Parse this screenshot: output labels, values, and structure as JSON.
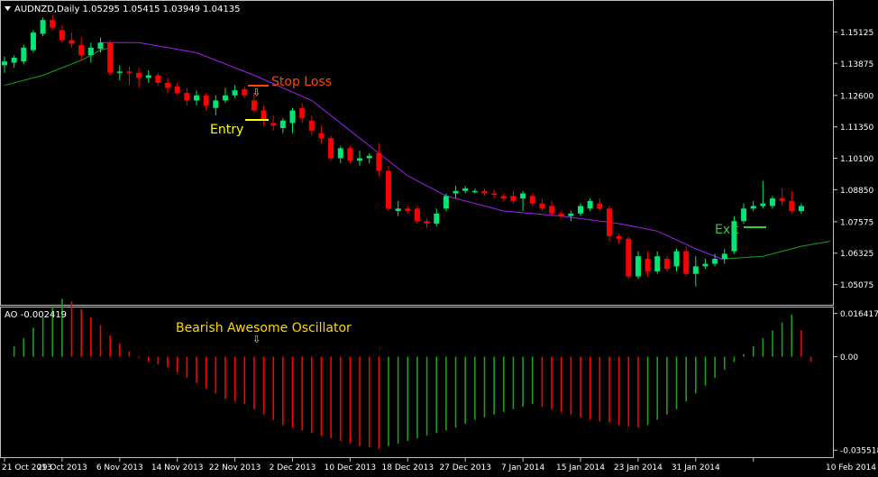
{
  "window": {
    "symbol_header": "AUDNZD,Daily  1.05295 1.05415 1.03949 1.04135",
    "indicator_header": "AO -0.002419"
  },
  "colors": {
    "background": "#000000",
    "frame": "#c0c0c0",
    "axis_text": "#ffffff",
    "bull": "#00e676",
    "bear": "#ff0000",
    "ma_purple": "#a020f0",
    "ma_green": "#1e9e1e",
    "ao_up": "#1e9e1e",
    "ao_down": "#ff0000",
    "entry_label": "#ffff00",
    "stop_label": "#ff4500",
    "exit_label": "#33cc33",
    "ao_label": "#ffd700"
  },
  "annotations": {
    "stop_loss": "Stop Loss",
    "entry": "Entry",
    "exit": "Exit",
    "ao_note": "Bearish Awesome Oscillator",
    "arrow_glyph": "⇩"
  },
  "chart_data": [
    {
      "type": "candlestick",
      "title": "AUDNZD,Daily",
      "ohlc_readout": [
        1.05295,
        1.05415,
        1.03949,
        1.04135
      ],
      "y_ticks": [
        1.15125,
        1.13875,
        1.126,
        1.1135,
        1.101,
        1.0885,
        1.07575,
        1.06325,
        1.05075
      ],
      "y_tick_labels": [
        "1.15125",
        "1.13875",
        "1.12600",
        "1.11350",
        "1.10100",
        "1.08850",
        "1.07575",
        "1.06325",
        "1.05075"
      ],
      "ylim": [
        1.0445,
        1.1575
      ],
      "x_tick_labels": [
        "21 Oct 2013",
        "29 Oct 2013",
        "6 Nov 2013",
        "14 Nov 2013",
        "22 Nov 2013",
        "2 Dec 2013",
        "10 Dec 2013",
        "18 Dec 2013",
        "27 Dec 2013",
        "7 Jan 2014",
        "15 Jan 2014",
        "23 Jan 2014",
        "31 Jan 2014",
        "10 Feb 2014"
      ],
      "x_tick_bar_index": [
        0,
        6,
        12,
        18,
        24,
        30,
        36,
        42,
        48,
        54,
        60,
        66,
        72,
        78
      ],
      "candles": [
        {
          "o": 1.138,
          "h": 1.1415,
          "l": 1.135,
          "c": 1.1395
        },
        {
          "o": 1.139,
          "h": 1.142,
          "l": 1.137,
          "c": 1.141
        },
        {
          "o": 1.1395,
          "h": 1.146,
          "l": 1.1385,
          "c": 1.145
        },
        {
          "o": 1.144,
          "h": 1.152,
          "l": 1.143,
          "c": 1.151
        },
        {
          "o": 1.1505,
          "h": 1.157,
          "l": 1.1495,
          "c": 1.156
        },
        {
          "o": 1.156,
          "h": 1.158,
          "l": 1.152,
          "c": 1.153
        },
        {
          "o": 1.152,
          "h": 1.154,
          "l": 1.147,
          "c": 1.148
        },
        {
          "o": 1.148,
          "h": 1.151,
          "l": 1.145,
          "c": 1.1465
        },
        {
          "o": 1.146,
          "h": 1.149,
          "l": 1.14,
          "c": 1.142
        },
        {
          "o": 1.142,
          "h": 1.147,
          "l": 1.139,
          "c": 1.145
        },
        {
          "o": 1.1445,
          "h": 1.149,
          "l": 1.143,
          "c": 1.147
        },
        {
          "o": 1.147,
          "h": 1.148,
          "l": 1.134,
          "c": 1.135
        },
        {
          "o": 1.135,
          "h": 1.138,
          "l": 1.132,
          "c": 1.1355
        },
        {
          "o": 1.1355,
          "h": 1.1375,
          "l": 1.13,
          "c": 1.135
        },
        {
          "o": 1.135,
          "h": 1.137,
          "l": 1.129,
          "c": 1.133
        },
        {
          "o": 1.133,
          "h": 1.136,
          "l": 1.131,
          "c": 1.134
        },
        {
          "o": 1.134,
          "h": 1.135,
          "l": 1.13,
          "c": 1.131
        },
        {
          "o": 1.131,
          "h": 1.133,
          "l": 1.127,
          "c": 1.129
        },
        {
          "o": 1.1295,
          "h": 1.131,
          "l": 1.126,
          "c": 1.127
        },
        {
          "o": 1.127,
          "h": 1.129,
          "l": 1.122,
          "c": 1.124
        },
        {
          "o": 1.124,
          "h": 1.128,
          "l": 1.122,
          "c": 1.126
        },
        {
          "o": 1.126,
          "h": 1.127,
          "l": 1.12,
          "c": 1.122
        },
        {
          "o": 1.121,
          "h": 1.126,
          "l": 1.118,
          "c": 1.124
        },
        {
          "o": 1.124,
          "h": 1.129,
          "l": 1.123,
          "c": 1.126
        },
        {
          "o": 1.126,
          "h": 1.13,
          "l": 1.125,
          "c": 1.128
        },
        {
          "o": 1.1285,
          "h": 1.1295,
          "l": 1.125,
          "c": 1.126
        },
        {
          "o": 1.124,
          "h": 1.127,
          "l": 1.119,
          "c": 1.12
        },
        {
          "o": 1.12,
          "h": 1.122,
          "l": 1.114,
          "c": 1.116
        },
        {
          "o": 1.115,
          "h": 1.118,
          "l": 1.112,
          "c": 1.114
        },
        {
          "o": 1.113,
          "h": 1.117,
          "l": 1.111,
          "c": 1.116
        },
        {
          "o": 1.115,
          "h": 1.121,
          "l": 1.111,
          "c": 1.12
        },
        {
          "o": 1.121,
          "h": 1.123,
          "l": 1.115,
          "c": 1.117
        },
        {
          "o": 1.116,
          "h": 1.118,
          "l": 1.11,
          "c": 1.112
        },
        {
          "o": 1.111,
          "h": 1.114,
          "l": 1.107,
          "c": 1.109
        },
        {
          "o": 1.109,
          "h": 1.11,
          "l": 1.1,
          "c": 1.101
        },
        {
          "o": 1.101,
          "h": 1.106,
          "l": 1.099,
          "c": 1.105
        },
        {
          "o": 1.105,
          "h": 1.106,
          "l": 1.099,
          "c": 1.1
        },
        {
          "o": 1.1,
          "h": 1.104,
          "l": 1.098,
          "c": 1.101
        },
        {
          "o": 1.101,
          "h": 1.103,
          "l": 1.099,
          "c": 1.102
        },
        {
          "o": 1.103,
          "h": 1.107,
          "l": 1.094,
          "c": 1.096
        },
        {
          "o": 1.096,
          "h": 1.098,
          "l": 1.08,
          "c": 1.081
        },
        {
          "o": 1.08,
          "h": 1.084,
          "l": 1.078,
          "c": 1.081
        },
        {
          "o": 1.081,
          "h": 1.082,
          "l": 1.079,
          "c": 1.08
        },
        {
          "o": 1.081,
          "h": 1.082,
          "l": 1.075,
          "c": 1.076
        },
        {
          "o": 1.076,
          "h": 1.077,
          "l": 1.073,
          "c": 1.075
        },
        {
          "o": 1.075,
          "h": 1.081,
          "l": 1.074,
          "c": 1.079
        },
        {
          "o": 1.081,
          "h": 1.087,
          "l": 1.08,
          "c": 1.086
        },
        {
          "o": 1.087,
          "h": 1.09,
          "l": 1.085,
          "c": 1.088
        },
        {
          "o": 1.088,
          "h": 1.09,
          "l": 1.087,
          "c": 1.089
        },
        {
          "o": 1.088,
          "h": 1.089,
          "l": 1.087,
          "c": 1.088
        },
        {
          "o": 1.088,
          "h": 1.089,
          "l": 1.086,
          "c": 1.087
        },
        {
          "o": 1.087,
          "h": 1.0885,
          "l": 1.085,
          "c": 1.0865
        },
        {
          "o": 1.086,
          "h": 1.087,
          "l": 1.084,
          "c": 1.085
        },
        {
          "o": 1.086,
          "h": 1.088,
          "l": 1.083,
          "c": 1.084
        },
        {
          "o": 1.085,
          "h": 1.088,
          "l": 1.08,
          "c": 1.087
        },
        {
          "o": 1.086,
          "h": 1.087,
          "l": 1.082,
          "c": 1.083
        },
        {
          "o": 1.083,
          "h": 1.085,
          "l": 1.08,
          "c": 1.081
        },
        {
          "o": 1.082,
          "h": 1.084,
          "l": 1.078,
          "c": 1.079
        },
        {
          "o": 1.079,
          "h": 1.08,
          "l": 1.077,
          "c": 1.078
        },
        {
          "o": 1.078,
          "h": 1.08,
          "l": 1.076,
          "c": 1.079
        },
        {
          "o": 1.079,
          "h": 1.083,
          "l": 1.078,
          "c": 1.082
        },
        {
          "o": 1.081,
          "h": 1.085,
          "l": 1.08,
          "c": 1.084
        },
        {
          "o": 1.083,
          "h": 1.085,
          "l": 1.08,
          "c": 1.081
        },
        {
          "o": 1.081,
          "h": 1.082,
          "l": 1.068,
          "c": 1.07
        },
        {
          "o": 1.07,
          "h": 1.071,
          "l": 1.067,
          "c": 1.069
        },
        {
          "o": 1.069,
          "h": 1.07,
          "l": 1.053,
          "c": 1.054
        },
        {
          "o": 1.054,
          "h": 1.064,
          "l": 1.053,
          "c": 1.062
        },
        {
          "o": 1.061,
          "h": 1.064,
          "l": 1.054,
          "c": 1.056
        },
        {
          "o": 1.056,
          "h": 1.064,
          "l": 1.055,
          "c": 1.062
        },
        {
          "o": 1.061,
          "h": 1.062,
          "l": 1.056,
          "c": 1.057
        },
        {
          "o": 1.058,
          "h": 1.065,
          "l": 1.056,
          "c": 1.064
        },
        {
          "o": 1.064,
          "h": 1.066,
          "l": 1.054,
          "c": 1.055
        },
        {
          "o": 1.055,
          "h": 1.062,
          "l": 1.05,
          "c": 1.058
        },
        {
          "o": 1.058,
          "h": 1.061,
          "l": 1.057,
          "c": 1.059
        },
        {
          "o": 1.059,
          "h": 1.063,
          "l": 1.058,
          "c": 1.061
        },
        {
          "o": 1.061,
          "h": 1.065,
          "l": 1.059,
          "c": 1.063
        },
        {
          "o": 1.064,
          "h": 1.078,
          "l": 1.063,
          "c": 1.076
        },
        {
          "o": 1.076,
          "h": 1.083,
          "l": 1.075,
          "c": 1.081
        },
        {
          "o": 1.081,
          "h": 1.084,
          "l": 1.08,
          "c": 1.082
        },
        {
          "o": 1.082,
          "h": 1.092,
          "l": 1.081,
          "c": 1.083
        },
        {
          "o": 1.082,
          "h": 1.086,
          "l": 1.081,
          "c": 1.085
        },
        {
          "o": 1.085,
          "h": 1.089,
          "l": 1.082,
          "c": 1.084
        },
        {
          "o": 1.084,
          "h": 1.088,
          "l": 1.079,
          "c": 1.08
        },
        {
          "o": 1.08,
          "h": 1.083,
          "l": 1.079,
          "c": 1.082
        }
      ],
      "ma_purple": [
        [
          10,
          1.147
        ],
        [
          14,
          1.147
        ],
        [
          20,
          1.143
        ],
        [
          26,
          1.134
        ],
        [
          32,
          1.124
        ],
        [
          38,
          1.106
        ],
        [
          42,
          1.094
        ],
        [
          46,
          1.086
        ],
        [
          52,
          1.08
        ],
        [
          58,
          1.078
        ],
        [
          64,
          1.075
        ],
        [
          68,
          1.072
        ],
        [
          72,
          1.065
        ],
        [
          75,
          1.0605
        ]
      ],
      "ma_green": [
        [
          0,
          1.13
        ],
        [
          4,
          1.134
        ],
        [
          8,
          1.14
        ],
        [
          10,
          1.144
        ],
        [
          11,
          1.145
        ]
      ],
      "ma_green_late": [
        [
          75,
          1.061
        ],
        [
          79,
          1.062
        ],
        [
          83,
          1.066
        ],
        [
          86,
          1.068
        ]
      ]
    },
    {
      "type": "bar",
      "title": "AO",
      "readout": -0.002419,
      "y_ticks": [
        0.016417,
        0.0,
        -0.035518
      ],
      "y_tick_labels": [
        "0.016417",
        "0.00",
        "-0.035518"
      ],
      "ylim": [
        -0.0375,
        0.018
      ],
      "values": [
        0.0,
        0.004,
        0.007,
        0.011,
        0.015,
        0.019,
        0.022,
        0.021,
        0.018,
        0.015,
        0.012,
        0.008,
        0.005,
        0.002,
        -0.0005,
        -0.002,
        -0.003,
        -0.004,
        -0.006,
        -0.008,
        -0.01,
        -0.012,
        -0.014,
        -0.016,
        -0.017,
        -0.018,
        -0.02,
        -0.022,
        -0.024,
        -0.026,
        -0.027,
        -0.028,
        -0.029,
        -0.03,
        -0.031,
        -0.032,
        -0.033,
        -0.034,
        -0.0345,
        -0.035,
        -0.034,
        -0.033,
        -0.032,
        -0.031,
        -0.03,
        -0.029,
        -0.028,
        -0.027,
        -0.0255,
        -0.024,
        -0.023,
        -0.022,
        -0.021,
        -0.02,
        -0.019,
        -0.018,
        -0.019,
        -0.02,
        -0.021,
        -0.022,
        -0.023,
        -0.024,
        -0.0245,
        -0.025,
        -0.026,
        -0.0265,
        -0.027,
        -0.026,
        -0.024,
        -0.022,
        -0.02,
        -0.017,
        -0.014,
        -0.011,
        -0.008,
        -0.005,
        -0.002,
        0.001,
        0.004,
        0.007,
        0.01,
        0.013,
        0.016,
        0.01,
        -0.002
      ]
    }
  ]
}
